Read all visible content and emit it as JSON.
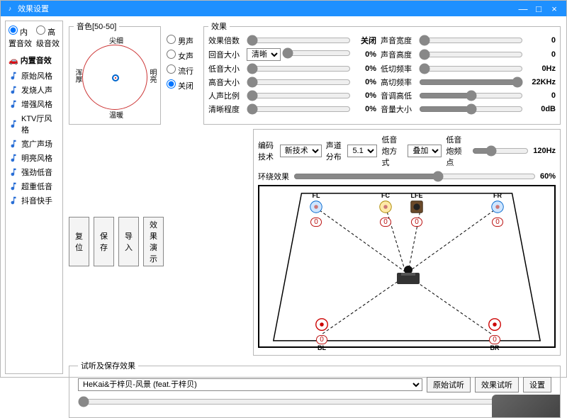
{
  "window": {
    "title": "效果设置",
    "minimize": "—",
    "maximize": "□",
    "close": "×"
  },
  "sidebar": {
    "radios": {
      "builtin": "内置音效",
      "advanced": "高级音效"
    },
    "header": "内置音效",
    "presets": [
      {
        "label": "原始风格"
      },
      {
        "label": "发烧人声"
      },
      {
        "label": "增强风格"
      },
      {
        "label": "KTV厅风格"
      },
      {
        "label": "宽广声场"
      },
      {
        "label": "明亮风格"
      },
      {
        "label": "强劲低音"
      },
      {
        "label": "超重低音"
      },
      {
        "label": "抖音快手"
      }
    ]
  },
  "timbre": {
    "legend": "音色[50-50]",
    "top": "尖细",
    "bottom": "温暖",
    "left": "浑厚",
    "right": "明亮"
  },
  "voice": {
    "male": "男声",
    "female": "女声",
    "pop": "流行",
    "off": "关闭"
  },
  "effects": {
    "legend": "效果",
    "rows": [
      {
        "l": "效果倍数",
        "r": "声音宽度",
        "lv": "关闭",
        "rv": "0"
      },
      {
        "l": "回音大小",
        "r": "声音高度",
        "lv": "0%",
        "rv": "0",
        "sel": "清晰"
      },
      {
        "l": "低音大小",
        "r": "低切频率",
        "lv": "0%",
        "rv": "0Hz"
      },
      {
        "l": "高音大小",
        "r": "高切频率",
        "lv": "0%",
        "rv": "22KHz"
      },
      {
        "l": "人声比例",
        "r": "音调高低",
        "lv": "0%",
        "rv": "0"
      },
      {
        "l": "清晰程度",
        "r": "音量大小",
        "lv": "0%",
        "rv": "0dB"
      }
    ],
    "selopts": [
      "清晰"
    ]
  },
  "buttons": {
    "reset": "复位",
    "save": "保存",
    "import": "导入",
    "demo": "效果演示"
  },
  "surround": {
    "enc_label": "编码技术",
    "enc_val": "新技术",
    "dist_label": "声道分布",
    "dist_val": "5.1",
    "bass_label": "低音炮方式",
    "bass_val": "叠加",
    "bassf_label": "低音炮频点",
    "bassf_val": "120Hz",
    "env_label": "环绕效果",
    "env_val": "60%",
    "speakers": {
      "FL": "FL",
      "FC": "FC",
      "LFE": "LFE",
      "FR": "FR",
      "BL": "BL",
      "BR": "BR",
      "zero": "0"
    }
  },
  "try": {
    "legend": "试听及保存效果",
    "track": "HeKai&于梓贝-风景 (feat.于梓贝)",
    "orig": "原始试听",
    "eff": "效果试听",
    "set": "设置"
  }
}
